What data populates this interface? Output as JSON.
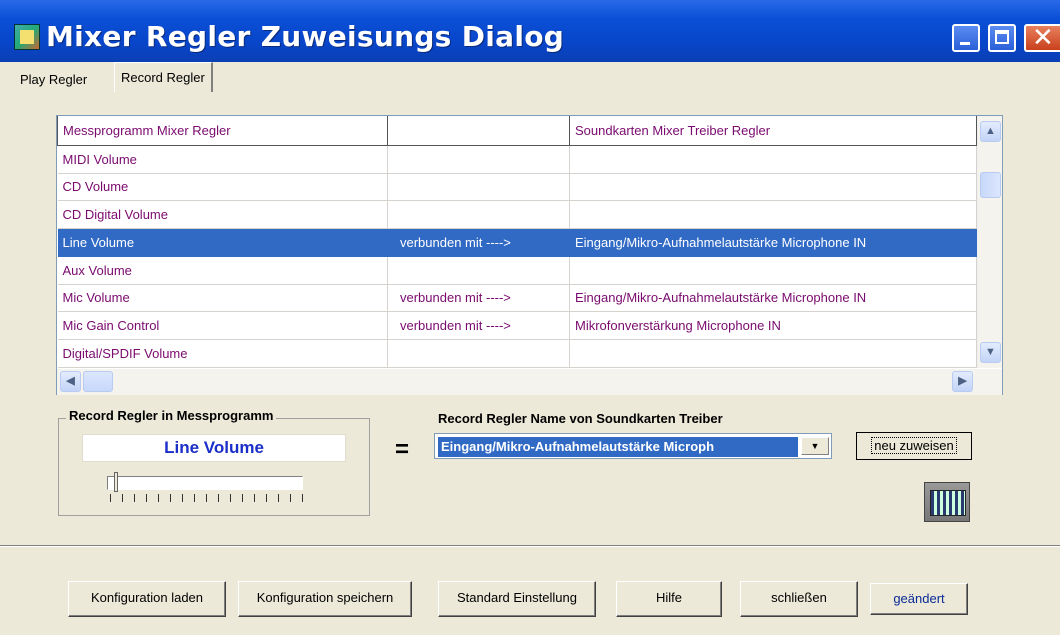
{
  "window": {
    "title": "Mixer Regler  Zuweisungs  Dialog"
  },
  "tabs": [
    "Play Regler",
    "Record Regler"
  ],
  "table": {
    "headers": [
      "Messprogramm Mixer Regler",
      "",
      "Soundkarten Mixer Treiber Regler"
    ],
    "rows": [
      [
        "MIDI Volume",
        "",
        ""
      ],
      [
        "CD Volume",
        "",
        ""
      ],
      [
        "CD Digital Volume",
        "",
        ""
      ],
      [
        "Line Volume",
        "verbunden mit ---->",
        "Eingang/Mikro-Aufnahmelautstärke Microphone IN"
      ],
      [
        "Aux Volume",
        "",
        ""
      ],
      [
        "Mic Volume",
        "verbunden mit ---->",
        "Eingang/Mikro-Aufnahmelautstärke Microphone IN"
      ],
      [
        "Mic Gain Control",
        "verbunden mit ---->",
        "Mikrofonverstärkung Microphone IN"
      ],
      [
        "Digital/SPDIF Volume",
        "",
        ""
      ]
    ],
    "selected_row": 3
  },
  "record_group": {
    "title": "Record Regler in  Messprogramm",
    "value": "Line Volume"
  },
  "equals": "=",
  "combo": {
    "label": "Record Regler Name von Soundkarten Treiber",
    "value": "Eingang/Mikro-Aufnahmelautstärke Microph"
  },
  "buttons": {
    "neu_zuweisen": "neu zuweisen",
    "konfiguration_laden": "Konfiguration laden",
    "konfiguration_speichern": "Konfiguration speichern",
    "standard_einstellung": "Standard Einstellung",
    "hilfe": "Hilfe",
    "schliessen": "schließen",
    "geaendert": "geändert"
  },
  "icons": {
    "app": "mixer-app-icon",
    "mixer": "mixer-board-icon",
    "minimize": "minimize-icon",
    "maximize": "maximize-icon",
    "close": "close-icon"
  },
  "colors": {
    "selection": "#316ac5",
    "row_text": "#7a0a6e",
    "title_bar": "#0845c9"
  }
}
